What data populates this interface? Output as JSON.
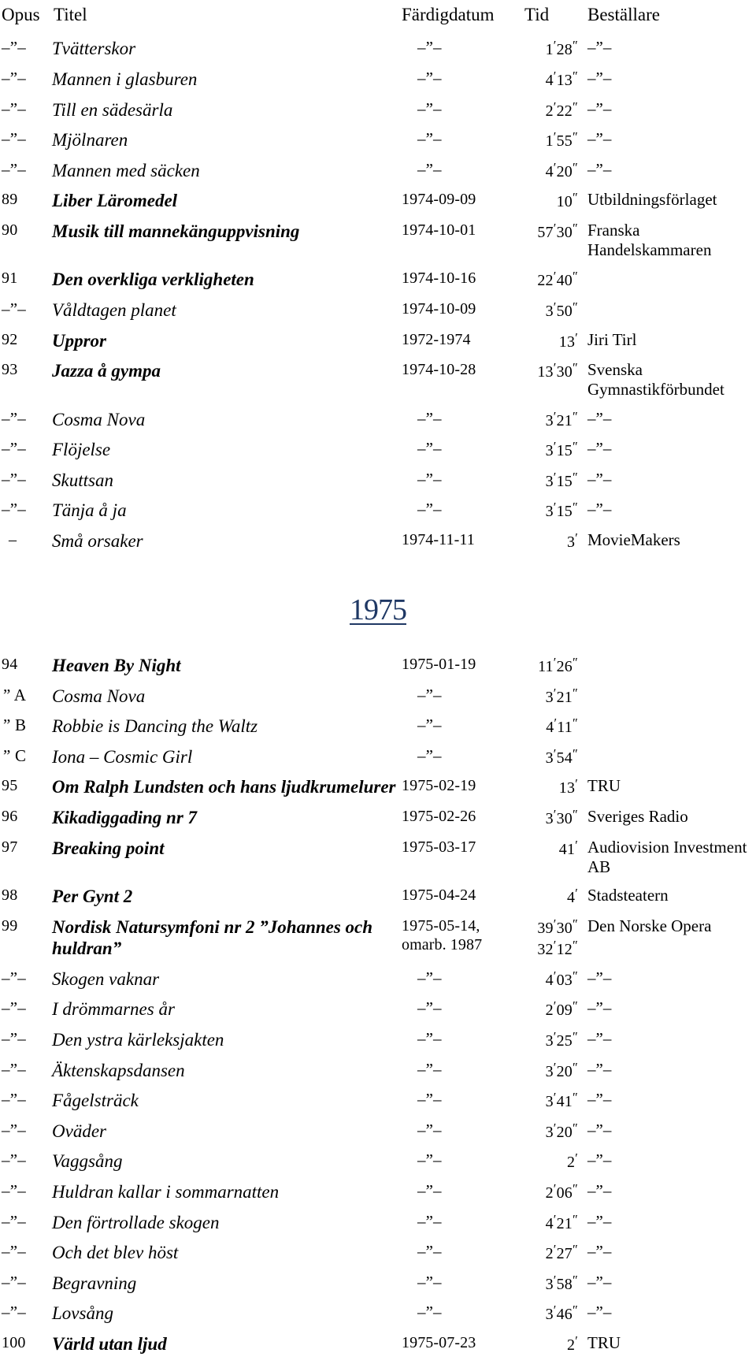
{
  "document": {
    "type": "work-list-table",
    "language": "sv"
  },
  "table": {
    "headers": {
      "opus": "Opus",
      "titel": "Titel",
      "fardigdatum": "Färdigdatum",
      "tid": "Tid",
      "bestallare": "Beställare"
    },
    "ditto_mark": "–”–",
    "rows": [
      {
        "opus": "–”–",
        "titel": "Tvätterskor",
        "datum": "–”–",
        "tid": "1′28″",
        "best": "–”–",
        "style": "minor"
      },
      {
        "opus": "–”–",
        "titel": "Mannen i glasburen",
        "datum": "–”–",
        "tid": "4′13″",
        "best": "–”–",
        "style": "minor"
      },
      {
        "opus": "–”–",
        "titel": "Till en sädesärla",
        "datum": "–”–",
        "tid": "2′22″",
        "best": "–”–",
        "style": "minor"
      },
      {
        "opus": "–”–",
        "titel": "Mjölnaren",
        "datum": "–”–",
        "tid": "1′55″",
        "best": "–”–",
        "style": "minor"
      },
      {
        "opus": "–”–",
        "titel": "Mannen med säcken",
        "datum": "–”–",
        "tid": "4′20″",
        "best": "–”–",
        "style": "minor"
      },
      {
        "opus": "89",
        "titel": "Liber Läromedel",
        "datum": "1974-09-09",
        "tid": "10″",
        "best": "Utbildningsförlaget",
        "style": "major"
      },
      {
        "opus": "90",
        "titel": "Musik till mannekänguppvisning",
        "datum": "1974-10-01",
        "tid": "57′30″",
        "best": "Franska Handelskammaren",
        "style": "major"
      },
      {
        "opus": "91",
        "titel": "Den overkliga verkligheten",
        "datum": "1974-10-16",
        "tid": "22′40″",
        "best": "",
        "style": "major"
      },
      {
        "opus": "–”–",
        "titel": "Våldtagen planet",
        "datum": "1974-10-09",
        "tid": "3′50″",
        "best": "",
        "style": "minor"
      },
      {
        "opus": "92",
        "titel": "Uppror",
        "datum": "1972-1974",
        "tid": "13′",
        "best": "Jiri Tirl",
        "style": "major"
      },
      {
        "opus": "93",
        "titel": "Jazza å gympa",
        "datum": "1974-10-28",
        "tid": "13′30″",
        "best": "Svenska Gymnastikförbundet",
        "style": "major"
      },
      {
        "opus": "–”–",
        "titel": "Cosma Nova",
        "datum": "–”–",
        "tid": "3′21″",
        "best": "–”–",
        "style": "minor"
      },
      {
        "opus": "–”–",
        "titel": "Flöjelse",
        "datum": "–”–",
        "tid": "3′15″",
        "best": "–”–",
        "style": "minor"
      },
      {
        "opus": "–”–",
        "titel": "Skuttsan",
        "datum": "–”–",
        "tid": "3′15″",
        "best": "–”–",
        "style": "minor"
      },
      {
        "opus": "–”–",
        "titel": "Tänja å ja",
        "datum": "–”–",
        "tid": "3′15″",
        "best": "–”–",
        "style": "minor"
      },
      {
        "opus": "–",
        "titel": "Små orsaker",
        "datum": "1974-11-11",
        "tid": "3′",
        "best": "MovieMakers",
        "style": "minor",
        "opus_variant": "single-dash"
      },
      {
        "year_divider": "1975"
      },
      {
        "opus": "94",
        "titel": "Heaven By Night",
        "datum": "1975-01-19",
        "tid": "11′26″",
        "best": "",
        "style": "major"
      },
      {
        "opus": "” A",
        "titel": "Cosma Nova",
        "datum": "–”–",
        "tid": "3′21″",
        "best": "",
        "style": "minor",
        "opus_variant": "sub-letter"
      },
      {
        "opus": "” B",
        "titel": "Robbie is Dancing the Waltz",
        "datum": "–”–",
        "tid": "4′11″",
        "best": "",
        "style": "minor",
        "opus_variant": "sub-letter"
      },
      {
        "opus": "” C",
        "titel": "Iona – Cosmic Girl",
        "datum": "–”–",
        "tid": "3′54″",
        "best": "",
        "style": "minor",
        "opus_variant": "sub-letter"
      },
      {
        "opus": "95",
        "titel": "Om Ralph Lundsten och hans ljudkrumelurer",
        "datum": "1975-02-19",
        "tid": "13′",
        "best": "TRU",
        "style": "major"
      },
      {
        "opus": "96",
        "titel": "Kikadiggading nr 7",
        "datum": "1975-02-26",
        "tid": "3′30″",
        "best": "Sveriges Radio",
        "style": "major"
      },
      {
        "opus": "97",
        "titel": "Breaking point",
        "datum": "1975-03-17",
        "tid": "41′",
        "best": "Audiovision Investment AB",
        "style": "major"
      },
      {
        "opus": "98",
        "titel": "Per Gynt 2",
        "datum": "1975-04-24",
        "tid": "4′",
        "best": "Stadsteatern",
        "style": "major"
      },
      {
        "opus": "99",
        "titel": "Nordisk Natursymfoni nr 2 ”Johannes och huldran”",
        "datum": "1975-05-14, omarb. 1987",
        "tid": "39′30″ 32′12″",
        "best": "Den Norske Opera",
        "style": "major"
      },
      {
        "opus": "–”–",
        "titel": "Skogen vaknar",
        "datum": "–”–",
        "tid": "4′03″",
        "best": "–”–",
        "style": "minor"
      },
      {
        "opus": "–”–",
        "titel": "I drömmarnes år",
        "datum": "–”–",
        "tid": "2′09″",
        "best": "–”–",
        "style": "minor"
      },
      {
        "opus": "–”–",
        "titel": "Den ystra kärleksjakten",
        "datum": "–”–",
        "tid": "3′25″",
        "best": "–”–",
        "style": "minor"
      },
      {
        "opus": "–”–",
        "titel": "Äktenskapsdansen",
        "datum": "–”–",
        "tid": "3′20″",
        "best": "–”–",
        "style": "minor"
      },
      {
        "opus": "–”–",
        "titel": "Fågelsträck",
        "datum": "–”–",
        "tid": "3′41″",
        "best": "–”–",
        "style": "minor"
      },
      {
        "opus": "–”–",
        "titel": "Oväder",
        "datum": "–”–",
        "tid": "3′20″",
        "best": "–”–",
        "style": "minor"
      },
      {
        "opus": "–”–",
        "titel": "Vaggsång",
        "datum": "–”–",
        "tid": "2′",
        "best": "–”–",
        "style": "minor"
      },
      {
        "opus": "–”–",
        "titel": "Huldran kallar i sommarnatten",
        "datum": "–”–",
        "tid": "2′06″",
        "best": "–”–",
        "style": "minor"
      },
      {
        "opus": "–”–",
        "titel": "Den förtrollade skogen",
        "datum": "–”–",
        "tid": "4′21″",
        "best": "–”–",
        "style": "minor"
      },
      {
        "opus": "–”–",
        "titel": "Och det blev höst",
        "datum": "–”–",
        "tid": "2′27″",
        "best": "–”–",
        "style": "minor"
      },
      {
        "opus": "–”–",
        "titel": "Begravning",
        "datum": "–”–",
        "tid": "3′58″",
        "best": "–”–",
        "style": "minor"
      },
      {
        "opus": "–”–",
        "titel": "Lovsång",
        "datum": "–”–",
        "tid": "3′46″",
        "best": "–”–",
        "style": "minor"
      },
      {
        "opus": "100",
        "titel": "Värld utan ljud",
        "datum": "1975-07-23",
        "tid": "2′",
        "best": "TRU",
        "style": "major"
      }
    ]
  },
  "colors": {
    "text": "#000000",
    "year_heading": "#1f3864",
    "background": "#ffffff"
  }
}
